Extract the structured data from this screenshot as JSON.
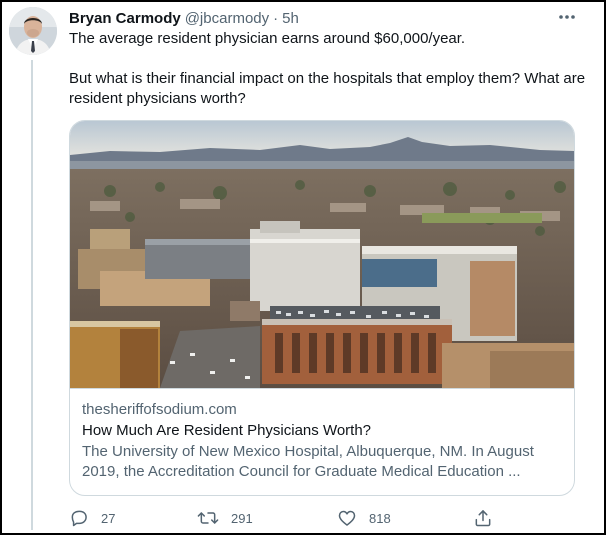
{
  "tweet": {
    "author_name": "Bryan Carmody",
    "handle": "@jbcarmody",
    "separator": "·",
    "time": "5h",
    "text_line1": "The average resident physician earns around $60,000/year.",
    "text_line2": "But what is their financial impact on the hospitals that employ them?  What are resident physicians worth?"
  },
  "card": {
    "domain": "thesheriffofsodium.com",
    "title": "How Much Are Resident Physicians Worth?",
    "description": "The University of New Mexico Hospital, Albuquerque, NM. In August 2019, the Accreditation Council for Graduate Medical Education ..."
  },
  "actions": {
    "reply_count": "27",
    "retweet_count": "291",
    "like_count": "818"
  },
  "colors": {
    "text_primary": "#0f1419",
    "text_secondary": "#536471",
    "border": "#cfd9de"
  },
  "icons": [
    "more-icon",
    "reply-icon",
    "retweet-icon",
    "like-icon",
    "share-icon"
  ]
}
